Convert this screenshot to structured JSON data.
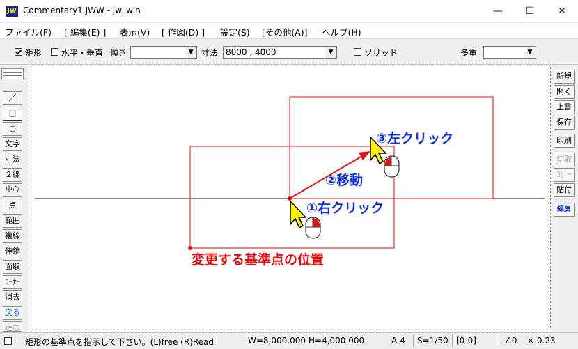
{
  "window": {
    "title": "Commentary1.JWW - jw_win",
    "icon_text": "JW",
    "minimize": "—",
    "maximize": "☐",
    "close": "✕"
  },
  "menu": [
    "ファイル(F)",
    "[ 編集(E) ]",
    "表示(V)",
    "[ 作図(D) ]",
    "設定(S)",
    "[その他(A)]",
    "ヘルプ(H)"
  ],
  "toolbar": {
    "rect_label": "矩形",
    "rect_checked": true,
    "hv_label": "水平・垂直",
    "hv_checked": false,
    "tilt_label": "傾き",
    "tilt_value": "",
    "dim_label": "寸法",
    "dim_value": "8000 , 4000",
    "solid_label": "ソリッド",
    "solid_checked": false,
    "multi_label": "多重",
    "multi_value": ""
  },
  "left_tools": [
    "／",
    "□",
    "○",
    "文字",
    "寸法",
    "２線",
    "中心線",
    "点",
    "範囲",
    "複線",
    "伸縮",
    "面取",
    "ｺｰﾅｰ",
    "消去",
    "戻る",
    "進む"
  ],
  "right_tools": [
    "新規",
    "開く",
    "上書",
    "保存",
    "印刷",
    "切取",
    "ｺﾋﾟｰ",
    "貼付",
    "線属性"
  ],
  "annotations": {
    "step1": "①右クリック",
    "step2": "②移動",
    "step3": "③左クリック",
    "base_point": "変更する基準点の位置"
  },
  "status": {
    "message": "矩形の基準点を指示して下さい。(L)free (R)Read",
    "width": "W=8,000.000",
    "height": "H=4,000.000",
    "paper": "A-4",
    "scale": "S=1/50",
    "layer": "[0-0]",
    "angle": "∠0",
    "zoom": "× 0.23"
  },
  "colors": {
    "rect": "#e01010",
    "annotation_red": "#e01010",
    "annotation_blue": "#1030d0",
    "cursor": "#fff200",
    "canvas_border": "#b04aa6"
  }
}
